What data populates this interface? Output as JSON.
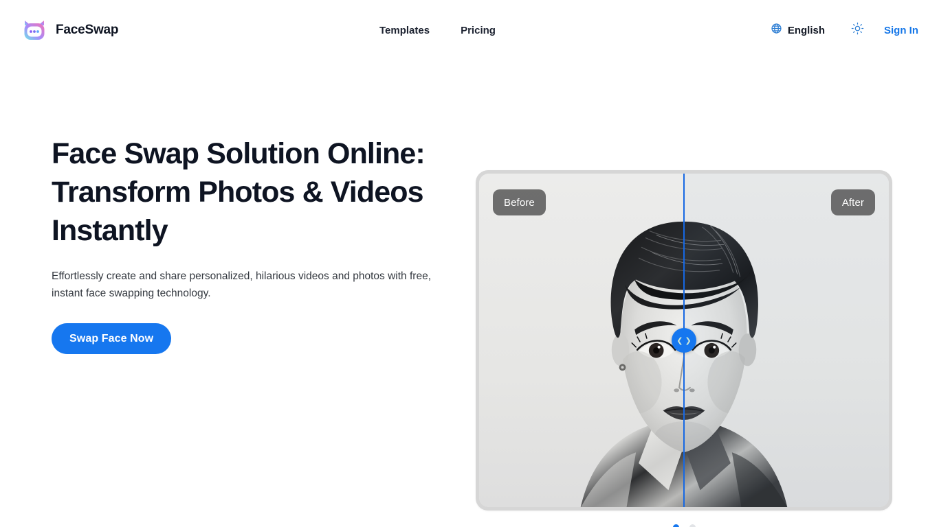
{
  "header": {
    "brand": {
      "name": "FaceSwap",
      "logo_icon": "cat-face-logo-icon",
      "gradient_from": "#8b5cf6",
      "gradient_to": "#f472b6"
    },
    "nav": [
      {
        "label": "Templates",
        "name": "templates"
      },
      {
        "label": "Pricing",
        "name": "pricing"
      }
    ],
    "language": {
      "label": "English",
      "icon": "globe-icon",
      "icon_color": "#2f7fd4"
    },
    "theme_toggle": {
      "icon": "sun-icon",
      "icon_color": "#2f7fd4"
    },
    "sign_in": {
      "label": "Sign In",
      "color": "#1677e8"
    }
  },
  "hero": {
    "title": "Face Swap Solution Online: Transform Photos & Videos Instantly",
    "subtitle": "Effortlessly create and share personalized, hilarious videos and photos with free, instant face swapping technology.",
    "cta": {
      "label": "Swap Face Now",
      "background": "#1677ef",
      "text_color": "#ffffff"
    }
  },
  "compare": {
    "before_label": "Before",
    "after_label": "After",
    "slider_position_percent": 50,
    "slider_icon": "left-right-chevron-icon",
    "divider_color": "#1668e3",
    "handle_color": "#1677ef",
    "image_description": "Black and white portrait of a woman with short dark hair, split vertically for before/after face swap comparison"
  },
  "carousel": {
    "dots": [
      {
        "active": true
      },
      {
        "active": false
      }
    ],
    "active_color": "#1677ef",
    "inactive_color": "#e2e4e7"
  }
}
